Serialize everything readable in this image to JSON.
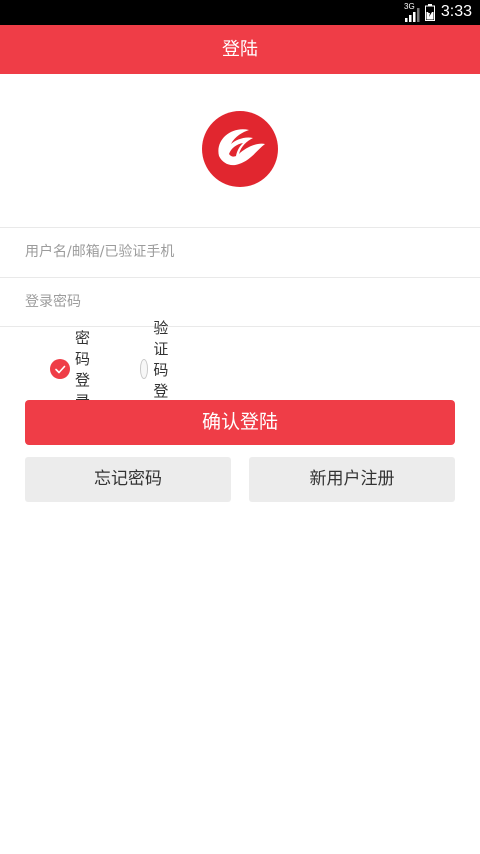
{
  "status_bar": {
    "network": "3G",
    "time": "3:33"
  },
  "header": {
    "title": "登陆"
  },
  "form": {
    "username_placeholder": "用户名/邮箱/已验证手机",
    "password_placeholder": "登录密码"
  },
  "login_mode": {
    "options": [
      {
        "label": "密码登录",
        "selected": true
      },
      {
        "label": "验证码登录",
        "selected": false
      }
    ]
  },
  "buttons": {
    "confirm_label": "确认登陆",
    "forgot_label": "忘记密码",
    "register_label": "新用户注册"
  },
  "colors": {
    "accent": "#EF3D47",
    "secondary_button": "#ECECEC"
  },
  "icons": [
    "app-logo-icon",
    "checkmark-icon",
    "signal-icon",
    "battery-icon"
  ]
}
